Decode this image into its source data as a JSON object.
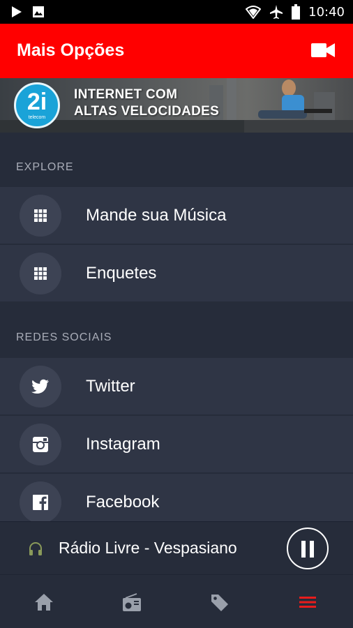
{
  "status_bar": {
    "time": "10:40",
    "icons": [
      "play-icon",
      "image-icon",
      "wifi-icon",
      "airplane-icon",
      "battery-icon"
    ]
  },
  "app_bar": {
    "title": "Mais Opções",
    "action_icon": "video-camera-icon"
  },
  "banner": {
    "logo_text": "2i",
    "logo_sub": "telecom",
    "headline_line1": "INTERNET COM",
    "headline_line2": "ALTAS VELOCIDADES"
  },
  "sections": [
    {
      "header": "EXPLORE",
      "items": [
        {
          "label": "Mande sua Música",
          "icon": "grid-icon"
        },
        {
          "label": "Enquetes",
          "icon": "grid-icon"
        }
      ]
    },
    {
      "header": "REDES SOCIAIS",
      "items": [
        {
          "label": "Twitter",
          "icon": "twitter-icon"
        },
        {
          "label": "Instagram",
          "icon": "instagram-icon"
        },
        {
          "label": "Facebook",
          "icon": "facebook-icon"
        }
      ]
    }
  ],
  "player": {
    "station": "Rádio Livre - Vespasiano",
    "state_icon": "pause-icon"
  },
  "bottom_nav": [
    {
      "icon": "home-icon",
      "active": false
    },
    {
      "icon": "radio-icon",
      "active": false
    },
    {
      "icon": "tag-icon",
      "active": false
    },
    {
      "icon": "menu-icon",
      "active": true
    }
  ],
  "colors": {
    "accent": "#ff0000",
    "background": "#262c3a",
    "item_background": "#2f3545",
    "icon_circle": "#3d4354",
    "inactive_icon": "#9aa0ab"
  }
}
